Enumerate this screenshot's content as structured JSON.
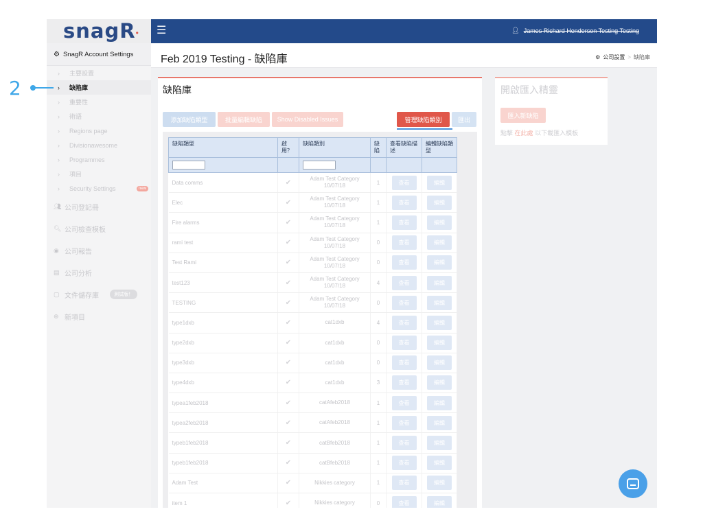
{
  "annotation": {
    "number": "2"
  },
  "sidebar": {
    "logo": "snagR",
    "account_settings": "SnagR Account Settings",
    "sub_items": [
      {
        "label": "主要設置",
        "active": false
      },
      {
        "label": "缺陷庫",
        "active": true
      },
      {
        "label": "重要性",
        "active": false
      },
      {
        "label": "術語",
        "active": false
      },
      {
        "label": "Regions page",
        "active": false
      },
      {
        "label": "Divisionawesome",
        "active": false
      },
      {
        "label": "Programmes",
        "active": false
      },
      {
        "label": "項目",
        "active": false
      },
      {
        "label": "Security Settings",
        "active": false,
        "badge": "new"
      }
    ],
    "main_items": [
      {
        "label": "公司登記冊",
        "icon": "users-icon"
      },
      {
        "label": "公司檢查模板",
        "icon": "search-icon"
      },
      {
        "label": "公司報告",
        "icon": "globe-icon"
      },
      {
        "label": "公司分析",
        "icon": "bar-chart-icon"
      },
      {
        "label": "文件儲存庫",
        "icon": "clipboard-icon",
        "pill": "測試版！"
      },
      {
        "label": "新項目",
        "icon": "plus-circle-icon"
      }
    ]
  },
  "topbar": {
    "user_name": "James Richard Henderson Testing Testing"
  },
  "header": {
    "title": "Feb 2019 Testing - 缺陷庫",
    "breadcrumb": [
      "公司設置",
      "缺陷庫"
    ]
  },
  "panel": {
    "title": "缺陷庫",
    "buttons": {
      "add": "添加缺陷類型",
      "bulk": "批量編輯缺陷",
      "show_disabled": "Show Disabled Issues",
      "manage": "管理缺陷類別",
      "export": "匯出"
    },
    "table": {
      "headers": [
        "缺陷類型",
        "啟用？",
        "缺陷類別",
        "缺陷",
        "查看缺陷描述",
        "編輯缺陷類型"
      ],
      "view_label": "查看",
      "edit_label": "編輯",
      "rows": [
        {
          "type": "Data comms",
          "category": "Adam Test Category 10/07/18",
          "count": "1"
        },
        {
          "type": "Elec",
          "category": "Adam Test Category 10/07/18",
          "count": "1"
        },
        {
          "type": "Fire alarms",
          "category": "Adam Test Category 10/07/18",
          "count": "1"
        },
        {
          "type": "rami test",
          "category": "Adam Test Category 10/07/18",
          "count": "0"
        },
        {
          "type": "Test Rami",
          "category": "Adam Test Category 10/07/18",
          "count": "0"
        },
        {
          "type": "test123",
          "category": "Adam Test Category 10/07/18",
          "count": "4"
        },
        {
          "type": "TESTING",
          "category": "Adam Test Category 10/07/18",
          "count": "0"
        },
        {
          "type": "type1dxb",
          "category": "cat1dxb",
          "count": "4"
        },
        {
          "type": "type2dxb",
          "category": "cat1dxb",
          "count": "0"
        },
        {
          "type": "type3dxb",
          "category": "cat1dxb",
          "count": "0"
        },
        {
          "type": "type4dxb",
          "category": "cat1dxb",
          "count": "3"
        },
        {
          "type": "typea1feb2018",
          "category": "catAfeb2018",
          "count": "1"
        },
        {
          "type": "typea2feb2018",
          "category": "catAfeb2018",
          "count": "1"
        },
        {
          "type": "typeb1feb2018",
          "category": "catBfeb2018",
          "count": "1"
        },
        {
          "type": "typeb1feb2018",
          "category": "catBfeb2018",
          "count": "1"
        },
        {
          "type": "Adam Test",
          "category": "Nikkies category",
          "count": "1"
        },
        {
          "type": "item 1",
          "category": "Nikkies category",
          "count": "0"
        }
      ]
    }
  },
  "import_panel": {
    "title": "開啟匯入精靈",
    "button": "匯入新缺陷",
    "hint_prefix": "點擊",
    "hint_link": "在此處",
    "hint_suffix": "以下載匯入模板"
  }
}
